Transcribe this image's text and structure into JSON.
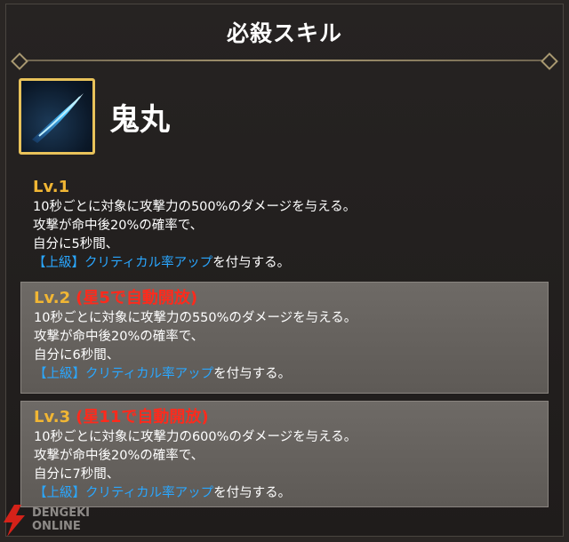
{
  "header": {
    "title": "必殺スキル"
  },
  "skill": {
    "name": "鬼丸",
    "icon": "slash-icon"
  },
  "levels": [
    {
      "label": "Lv.1",
      "unlock": "",
      "line1": "10秒ごとに対象に攻撃力の500%のダメージを与える。",
      "line2": "攻撃が命中後20%の確率で、",
      "line3": "自分に5秒間、",
      "buff": "【上級】クリティカル率アップ",
      "tail": "を付与する。"
    },
    {
      "label": "Lv.2",
      "unlock": "(星5で自動開放)",
      "line1": "10秒ごとに対象に攻撃力の550%のダメージを与える。",
      "line2": "攻撃が命中後20%の確率で、",
      "line3": "自分に6秒間、",
      "buff": "【上級】クリティカル率アップ",
      "tail": "を付与する。"
    },
    {
      "label": "Lv.3",
      "unlock": "(星11で自動開放)",
      "line1": "10秒ごとに対象に攻撃力の600%のダメージを与える。",
      "line2": "攻撃が命中後20%の確率で、",
      "line3": "自分に7秒間、",
      "buff": "【上級】クリティカル率アップ",
      "tail": "を付与する。"
    }
  ],
  "watermark": {
    "line1": "DENGEKI",
    "line2": "ONLINE"
  },
  "colors": {
    "level_label": "#f1b634",
    "unlock": "#ff2a1c",
    "buff": "#2aa7ff"
  }
}
